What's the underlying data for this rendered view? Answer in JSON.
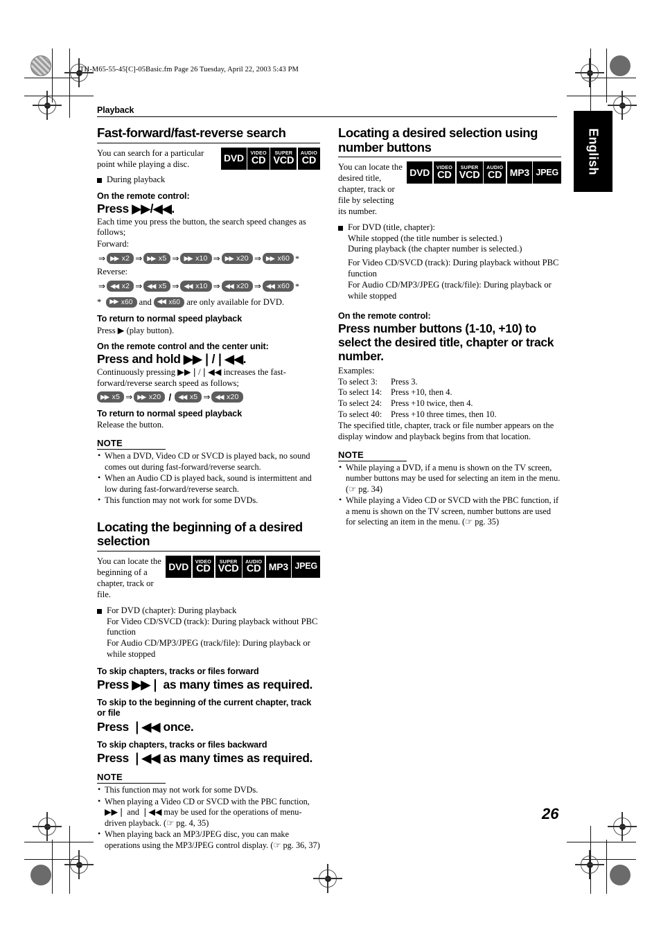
{
  "print_marks": {
    "file_stamp": "TH-M65-55-45[C]-05Basic.fm  Page 26  Tuesday, April 22, 2003  5:43 PM"
  },
  "lang_tab": {
    "label": "English"
  },
  "running_head": {
    "label": "Playback"
  },
  "page_number": "26",
  "badge_labels": {
    "dvd": "DVD",
    "video": "VIDEO",
    "cd": "CD",
    "super": "SUPER",
    "vcd": "VCD",
    "audio": "AUDIO",
    "mp3": "MP3",
    "jpeg": "JPEG"
  },
  "left_column": {
    "section1": {
      "title": "Fast-forward/fast-reverse search",
      "intro": "You can search for a particular point while playing a disc.",
      "bullet": "During playback",
      "lead1": "On the remote control:",
      "command1": "Press ▶▶/◀◀.",
      "desc1": "Each time you press the button, the search speed changes as follows;",
      "forward_label": "Forward:",
      "forward_speeds": [
        "x2",
        "x5",
        "x10",
        "x20",
        "x60"
      ],
      "reverse_label": "Reverse:",
      "reverse_speeds": [
        "x2",
        "x5",
        "x10",
        "x20",
        "x60"
      ],
      "footnote": {
        "star": "*",
        "speed_a": "x60",
        "mid": "and",
        "speed_b": "x60",
        "tail": "are only available for DVD."
      },
      "return_head1": "To return to normal speed playback",
      "return_text1": "Press ▶ (play button).",
      "lead2": "On the remote control and the center unit:",
      "command2": "Press and hold ▶▶❘/❘◀◀.",
      "desc2": "Continuously pressing ▶▶❘/❘◀◀ increases the fast-forward/reverse search speed as follows;",
      "hold_forward": [
        "x5",
        "x20"
      ],
      "hold_reverse": [
        "x5",
        "x20"
      ],
      "hold_separator": "/",
      "return_head2": "To return to normal speed playback",
      "return_text2": "Release the button.",
      "note_title": "NOTE",
      "notes": [
        "When a DVD, Video CD or SVCD is played back, no sound comes out during fast-forward/reverse search.",
        "When an Audio CD is played back, sound is intermittent and low during fast-forward/reverse search.",
        "This function may not work for some DVDs."
      ]
    },
    "section2": {
      "title": "Locating the beginning of a desired selection",
      "intro": "You can locate the beginning of a chapter, track or file.",
      "bullet_lines": [
        "For DVD (chapter): During playback",
        "For Video CD/SVCD (track): During playback without PBC function",
        "For Audio CD/MP3/JPEG (track/file): During playback or while stopped"
      ],
      "sub1": "To skip chapters, tracks or files forward",
      "cmd1": "Press ▶▶❘ as many times as required.",
      "sub2": "To skip to the beginning of the current chapter, track or file",
      "cmd2": "Press ❘◀◀ once.",
      "sub3": "To skip chapters, tracks or files backward",
      "cmd3": "Press ❘◀◀ as many times as required.",
      "note_title": "NOTE",
      "notes": [
        "This function may not work for some DVDs.",
        "When playing a Video CD or SVCD with the PBC function, ▶▶❘ and ❘◀◀ may be used for the operations of menu-driven playback. (☞ pg. 4, 35)",
        "When playing back an MP3/JPEG disc, you can make operations using the MP3/JPEG control display. (☞ pg. 36, 37)"
      ]
    }
  },
  "right_column": {
    "section1": {
      "title": "Locating a desired selection using number buttons",
      "intro": "You can locate the desired title, chapter, track or file by selecting its number.",
      "bullet_lines": [
        "For DVD (title, chapter):",
        "While stopped (the title number is selected.)",
        "During playback (the chapter number is selected.)",
        "For Video CD/SVCD (track): During playback without PBC function",
        "For Audio CD/MP3/JPEG (track/file): During playback or while stopped"
      ],
      "lead": "On the remote control:",
      "command": "Press number buttons (1-10, +10) to select the desired title, chapter or track number.",
      "examples_label": "Examples:",
      "examples": [
        {
          "key": "To select 3:",
          "value": "Press 3."
        },
        {
          "key": "To select 14:",
          "value": "Press +10, then 4."
        },
        {
          "key": "To select 24:",
          "value": "Press +10 twice, then 4."
        },
        {
          "key": "To select 40:",
          "value": "Press +10 three times, then 10."
        }
      ],
      "examples_tail": "The specified title, chapter, track or file number appears on the display window and playback begins from that location.",
      "note_title": "NOTE",
      "notes": [
        "While playing a DVD, if a menu is shown on the TV screen, number buttons may be used for selecting an item in the menu. (☞ pg. 34)",
        "While playing a Video CD or SVCD with the PBC function, if a menu is shown on the TV screen, number buttons are used for selecting an item in the menu. (☞ pg. 35)"
      ]
    }
  }
}
